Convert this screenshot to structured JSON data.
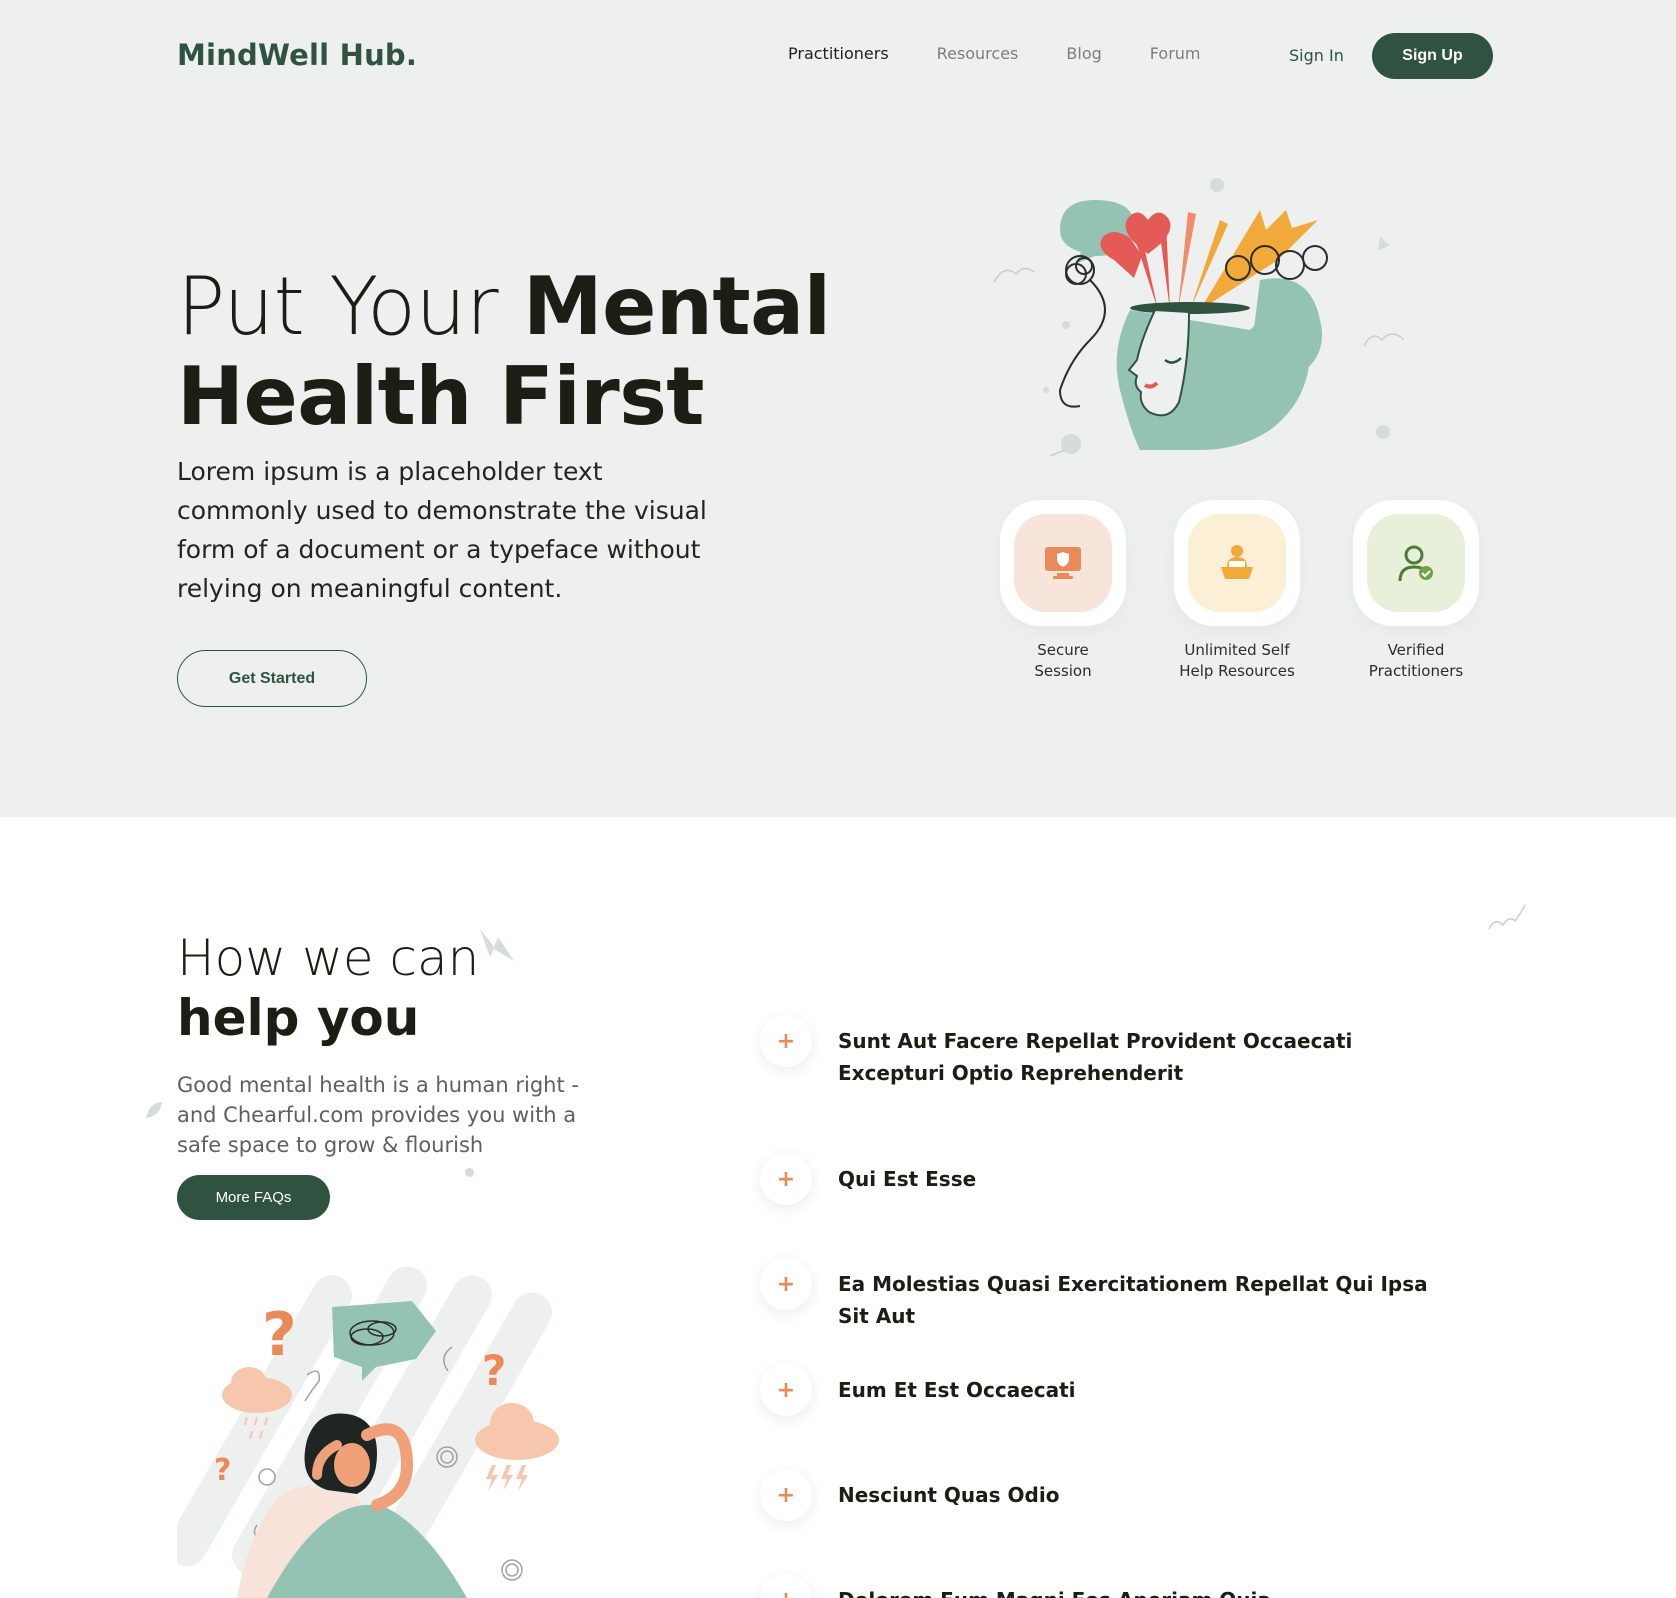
{
  "brand": {
    "logo": "MindWell Hub."
  },
  "nav": {
    "items": [
      {
        "label": "Practitioners",
        "active": true
      },
      {
        "label": "Resources",
        "active": false
      },
      {
        "label": "Blog",
        "active": false
      },
      {
        "label": "Forum",
        "active": false
      }
    ],
    "sign_in": "Sign In",
    "sign_up": "Sign Up"
  },
  "hero": {
    "title_thin": "Put Your ",
    "title_bold_1": "Mental",
    "title_bold_2": "Health First",
    "description": "Lorem ipsum is a placeholder text commonly used to demonstrate the visual form of a document or a typeface without relying on meaningful content.",
    "cta": "Get Started",
    "illustration_icon": "mind-head-illustration",
    "features": [
      {
        "label_1": "Secure",
        "label_2": "Session",
        "icon": "secure-monitor-icon",
        "bg": "#f7e5dc"
      },
      {
        "label_1": "Unlimited Self",
        "label_2": "Help Resources",
        "icon": "self-help-desk-icon",
        "bg": "#fbefd6"
      },
      {
        "label_1": "Verified",
        "label_2": "Practitioners",
        "icon": "verified-user-icon",
        "bg": "#e8f0d9"
      }
    ]
  },
  "help": {
    "title_thin": "How we can",
    "title_bold": "help you",
    "description": "Good mental health is a human right - and Chearful.com provides you with a safe space to grow & flourish",
    "cta": "More FAQs",
    "illustration_icon": "stressed-woman-illustration"
  },
  "faqs": [
    {
      "question": "Sunt Aut Facere Repellat Provident Occaecati Excepturi Optio Reprehenderit"
    },
    {
      "question": "Qui Est Esse"
    },
    {
      "question": "Ea Molestias Quasi Exercitationem Repellat Qui Ipsa Sit Aut"
    },
    {
      "question": "Eum Et Est Occaecati"
    },
    {
      "question": "Nesciunt Quas Odio"
    },
    {
      "question": "Dolorem Eum Magni Eos Aperiam Quia"
    }
  ],
  "colors": {
    "brand_green": "#2f5241",
    "hero_bg": "#edf0ee",
    "accent_orange": "#e98a58",
    "mint": "#95c3b3"
  }
}
